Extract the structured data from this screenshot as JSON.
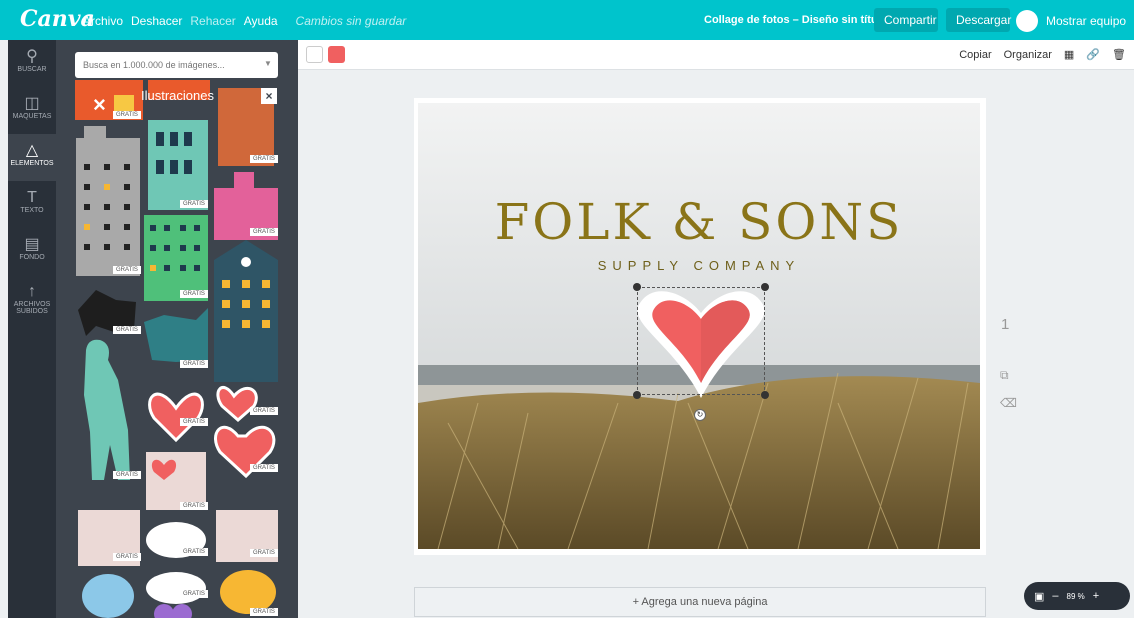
{
  "topbar": {
    "logo": "Canva",
    "menu": [
      "Archivo",
      "Deshacer",
      "Rehacer",
      "Ayuda"
    ],
    "unsaved": "Cambios sin guardar",
    "doc_title": "Collage de fotos – Diseño sin título",
    "share": "Compartir",
    "download": "Descargar",
    "team": "Mostrar equipo"
  },
  "rail": [
    {
      "label": "BUSCAR",
      "icon": "search-icon"
    },
    {
      "label": "MAQUETAS",
      "icon": "layout-icon"
    },
    {
      "label": "ELEMENTOS",
      "icon": "shapes-icon"
    },
    {
      "label": "TEXTO",
      "icon": "text-icon"
    },
    {
      "label": "FONDO",
      "icon": "pattern-icon"
    },
    {
      "label": "ARCHIVOS SUBIDOS",
      "icon": "upload-arrow-icon"
    }
  ],
  "panel": {
    "search_placeholder": "Busca en 1.000.000 de imágenes...",
    "category": "Ilustraciones",
    "badge": "GRATIS"
  },
  "options": {
    "copy": "Copiar",
    "arrange": "Organizar"
  },
  "canvas": {
    "headline": "FOLK & SONS",
    "subline": "SUPPLY COMPANY",
    "page_number": "1",
    "add_page": "+ Agrega una nueva página"
  },
  "zoom": {
    "value": "89 %",
    "minus": "–",
    "plus": "+"
  },
  "colors": {
    "accent": "#00c4cc",
    "heart": "#f06060",
    "title": "#8a7418"
  }
}
